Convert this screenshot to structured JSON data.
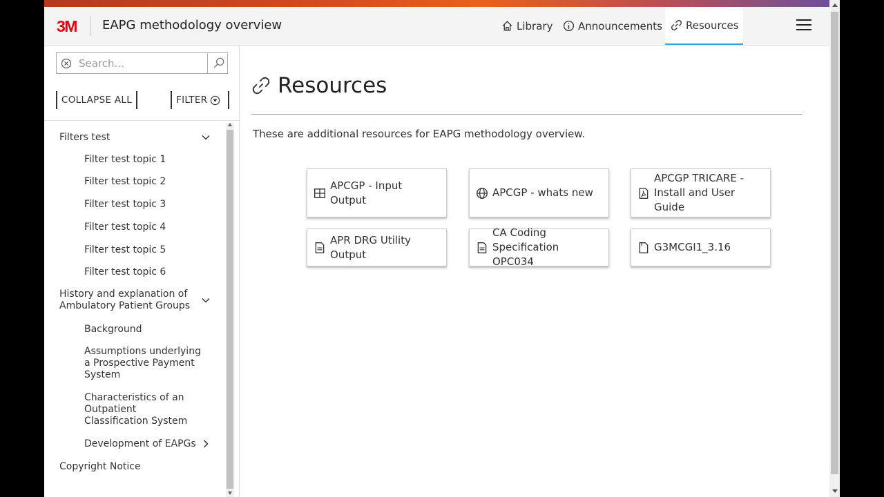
{
  "header": {
    "logo_text": "3M",
    "title": "EAPG methodology overview",
    "nav": [
      {
        "label": "Library",
        "icon": "home-icon"
      },
      {
        "label": "Announcements",
        "icon": "info-icon"
      },
      {
        "label": "Resources",
        "icon": "link-icon",
        "active": true
      }
    ],
    "menu_icon": "hamburger-menu-icon"
  },
  "sidebar": {
    "search_placeholder": "Search...",
    "collapse_all_label": "COLLAPSE ALL",
    "filter_label": "FILTER",
    "tree": [
      {
        "label": "Filters test",
        "expanded": true,
        "children": [
          "Filter test topic 1",
          "Filter test topic 2",
          "Filter test topic 3",
          "Filter test topic 4",
          "Filter test topic 5",
          "Filter test topic 6"
        ]
      },
      {
        "label": "History and explanation of Ambulatory Patient Groups",
        "expanded": true,
        "children": [
          "Background",
          "Assumptions underlying a Prospective Payment System",
          "Characteristics of an Outpatient Classification System",
          "Development of EAPGs"
        ]
      },
      {
        "label": "Copyright Notice"
      }
    ]
  },
  "main": {
    "title": "Resources",
    "intro": "These are additional resources for EAPG methodology overview.",
    "cards": [
      {
        "label": "APCGP - Input Output",
        "icon": "table-icon"
      },
      {
        "label": "APCGP - whats new",
        "icon": "globe-icon"
      },
      {
        "label": "APCGP TRICARE - Install and User Guide",
        "icon": "pdf-icon"
      },
      {
        "label": "APR DRG Utility Output",
        "icon": "document-icon"
      },
      {
        "label": "CA Coding Specification OPC034",
        "icon": "document-icon"
      },
      {
        "label": "G3MCGI1_3.16",
        "icon": "file-icon"
      }
    ]
  },
  "colors": {
    "brand_red": "#e60012",
    "active_tab_underline": "#3aa0d8"
  }
}
